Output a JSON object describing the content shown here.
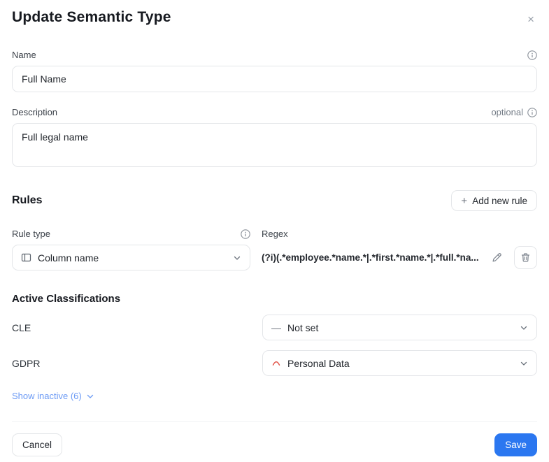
{
  "modal": {
    "title": "Update Semantic Type",
    "close_icon": "×"
  },
  "fields": {
    "name": {
      "label": "Name",
      "value": "Full Name"
    },
    "description": {
      "label": "Description",
      "optional_tag": "optional",
      "value": "Full legal name"
    }
  },
  "rules": {
    "heading": "Rules",
    "add_button_label": "Add new rule",
    "add_button_icon": "+",
    "rule": {
      "rule_type_label": "Rule type",
      "rule_type_value": "Column name",
      "regex_label": "Regex",
      "regex_value": "(?i)(.*employee.*name.*|.*first.*name.*|.*full.*na..."
    }
  },
  "classifications": {
    "heading": "Active Classifications",
    "rows": [
      {
        "label": "CLE",
        "value": "Not set",
        "icon": "dash"
      },
      {
        "label": "GDPR",
        "value": "Personal Data",
        "icon": "red-chevron-up"
      }
    ],
    "show_inactive_label": "Show inactive (6)",
    "dash_glyph": "—"
  },
  "footer": {
    "cancel_label": "Cancel",
    "save_label": "Save"
  },
  "colors": {
    "accent_blue": "#2b77f0",
    "link_blue": "#6d9bf5",
    "gdpr_icon_red": "#e2574c",
    "border_gray": "#e4e6e9"
  }
}
